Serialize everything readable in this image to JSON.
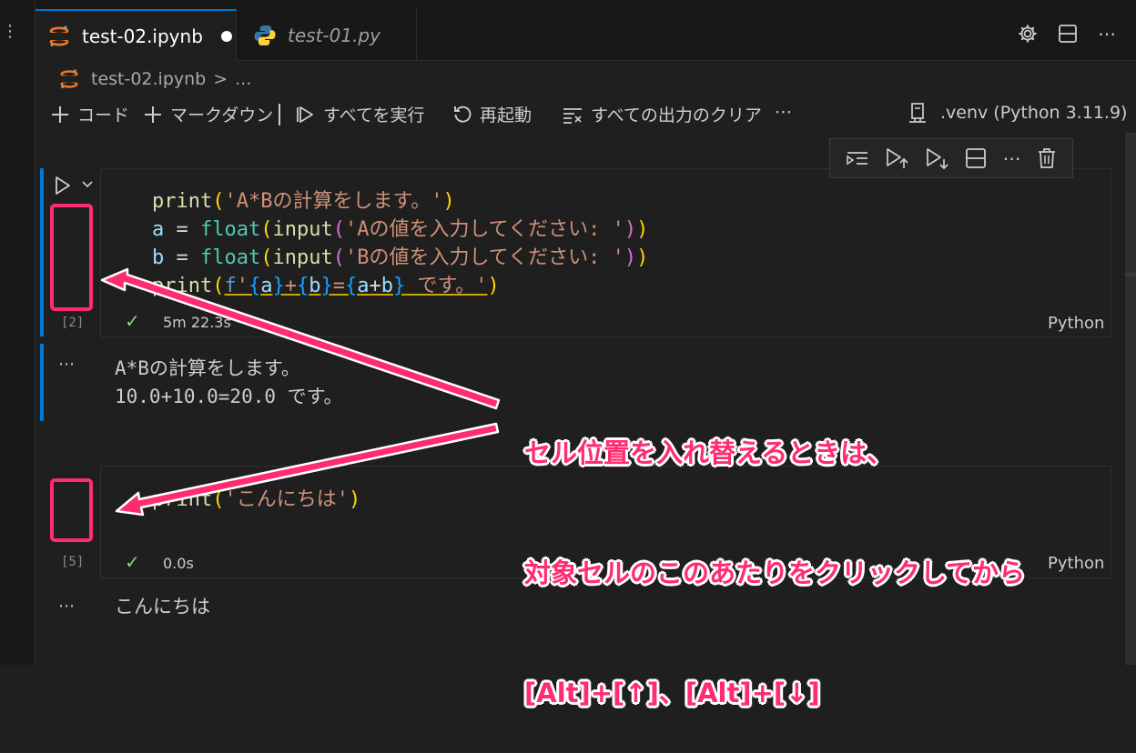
{
  "tabs": [
    {
      "label": "test-02.ipynb",
      "modified": true,
      "active": true
    },
    {
      "label": "test-01.py",
      "active": false
    }
  ],
  "breadcrumb": {
    "file": "test-02.ipynb",
    "separator": ">",
    "more": "..."
  },
  "toolbar": {
    "add_code": "コード",
    "add_markdown": "マークダウン",
    "run_all": "すべてを実行",
    "restart": "再起動",
    "clear_outputs": "すべての出力のクリア",
    "more": "⋯",
    "kernel": ".venv (Python 3.11.9)"
  },
  "cells": [
    {
      "exec_count": "[2]",
      "status_time": "5m 22.3s",
      "language": "Python",
      "output_lines": [
        "A*Bの計算をします。",
        "10.0+10.0=20.0 です。"
      ]
    },
    {
      "exec_count": "[5]",
      "status_time": "0.0s",
      "language": "Python",
      "output_lines": [
        "こんにちは"
      ]
    }
  ],
  "annotation": {
    "line1": "セル位置を入れ替えるときは、",
    "line2": "対象セルのこのあたりをクリックしてから",
    "line3": "[Alt]+[↑]、[Alt]+[↓]"
  },
  "colors": {
    "accent": "#0078d4",
    "annotation": "#ff2d6f",
    "success": "#89d185"
  }
}
